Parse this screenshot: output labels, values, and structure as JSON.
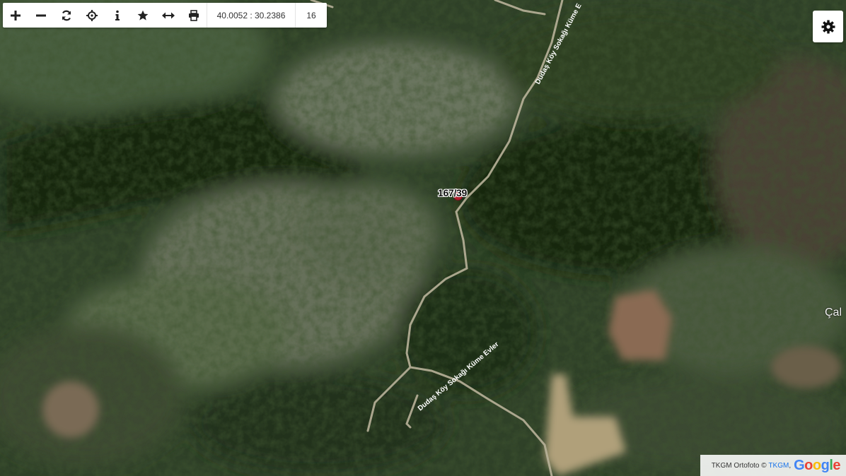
{
  "toolbar": {
    "buttons": [
      {
        "name": "zoom-in-button",
        "icon": "plus-icon"
      },
      {
        "name": "zoom-out-button",
        "icon": "minus-icon"
      },
      {
        "name": "refresh-button",
        "icon": "refresh-icon"
      },
      {
        "name": "locate-button",
        "icon": "crosshair-icon"
      },
      {
        "name": "info-button",
        "icon": "info-icon"
      },
      {
        "name": "favorite-button",
        "icon": "star-icon"
      },
      {
        "name": "measure-button",
        "icon": "horizontal-arrows-icon"
      },
      {
        "name": "print-button",
        "icon": "printer-icon"
      }
    ],
    "coordinates": "40.0052 : 30.2386",
    "zoom_level": "16"
  },
  "settings": {
    "icon": "gear-icon"
  },
  "map": {
    "parcel_label": "167/39",
    "road_label_1": "Dudaş Köy Sokağı Küme E",
    "road_label_2": "Dudaş Köy Sokağı Küme Evler",
    "place_label_partial": "Çal",
    "marker_color": "#b22030"
  },
  "attribution": {
    "text": "TKGM Ortofoto ©",
    "link": "TKGM",
    "separator": ",",
    "logo": "Google"
  }
}
